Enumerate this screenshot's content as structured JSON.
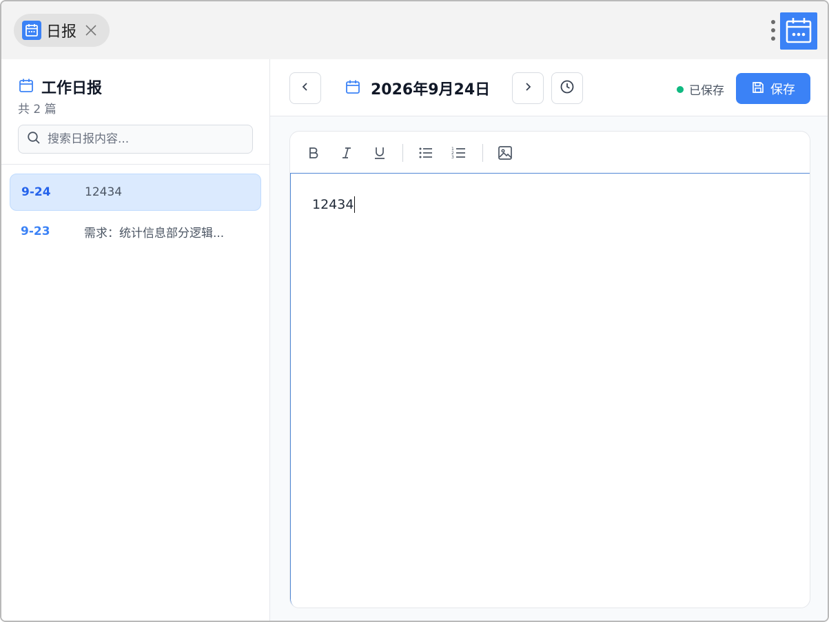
{
  "tab": {
    "label": "日报"
  },
  "sidebar": {
    "title": "工作日报",
    "count": "共 2 篇",
    "search_placeholder": "搜索日报内容...",
    "entries": [
      {
        "date": "9-24",
        "text": "12434",
        "selected": true
      },
      {
        "date": "9-23",
        "text": "需求：统计信息部分逻辑...",
        "selected": false
      }
    ]
  },
  "main": {
    "date": "2026年9月24日",
    "status": "已保存",
    "save_label": "保存"
  },
  "editor": {
    "content": "12434",
    "tools": [
      "bold-icon",
      "italic-icon",
      "underline-icon",
      "bullet-list-icon",
      "numbered-list-icon",
      "image-icon"
    ]
  },
  "colors": {
    "accent": "#3b82f6",
    "selected_bg": "#dbeafe",
    "status_dot": "#10b981"
  }
}
